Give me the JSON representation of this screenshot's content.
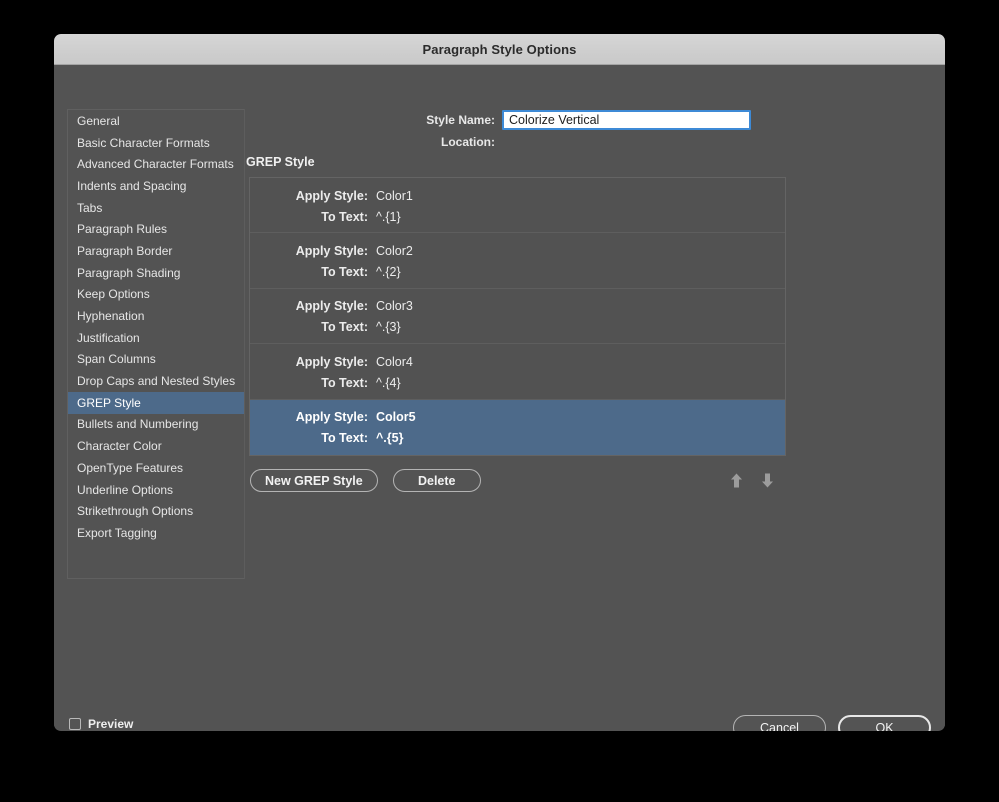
{
  "window": {
    "title": "Paragraph Style Options"
  },
  "sidebar": {
    "items": [
      {
        "label": "General",
        "selected": false
      },
      {
        "label": "Basic Character Formats",
        "selected": false
      },
      {
        "label": "Advanced Character Formats",
        "selected": false
      },
      {
        "label": "Indents and Spacing",
        "selected": false
      },
      {
        "label": "Tabs",
        "selected": false
      },
      {
        "label": "Paragraph Rules",
        "selected": false
      },
      {
        "label": "Paragraph Border",
        "selected": false
      },
      {
        "label": "Paragraph Shading",
        "selected": false
      },
      {
        "label": "Keep Options",
        "selected": false
      },
      {
        "label": "Hyphenation",
        "selected": false
      },
      {
        "label": "Justification",
        "selected": false
      },
      {
        "label": "Span Columns",
        "selected": false
      },
      {
        "label": "Drop Caps and Nested Styles",
        "selected": false
      },
      {
        "label": "GREP Style",
        "selected": true
      },
      {
        "label": "Bullets and Numbering",
        "selected": false
      },
      {
        "label": "Character Color",
        "selected": false
      },
      {
        "label": "OpenType Features",
        "selected": false
      },
      {
        "label": "Underline Options",
        "selected": false
      },
      {
        "label": "Strikethrough Options",
        "selected": false
      },
      {
        "label": "Export Tagging",
        "selected": false
      }
    ]
  },
  "header": {
    "style_name_label": "Style Name:",
    "style_name_value": "Colorize Vertical",
    "location_label": "Location:",
    "location_value": ""
  },
  "main": {
    "section_label": "GREP Style",
    "apply_style_label": "Apply Style:",
    "to_text_label": "To Text:",
    "rows": [
      {
        "apply_style": "Color1",
        "to_text": "^.{1}",
        "selected": false
      },
      {
        "apply_style": "Color2",
        "to_text": "^.{2}",
        "selected": false
      },
      {
        "apply_style": "Color3",
        "to_text": "^.{3}",
        "selected": false
      },
      {
        "apply_style": "Color4",
        "to_text": "^.{4}",
        "selected": false
      },
      {
        "apply_style": "Color5",
        "to_text": "^.{5}",
        "selected": true
      }
    ],
    "new_grep_style_label": "New GREP Style",
    "delete_label": "Delete",
    "move_up_icon": "arrow-up-icon",
    "move_down_icon": "arrow-down-icon"
  },
  "footer": {
    "preview_label": "Preview",
    "preview_checked": false,
    "cancel_label": "Cancel",
    "ok_label": "OK"
  },
  "colors": {
    "dialog_background": "#535353",
    "titlebar": "#d0d0d0",
    "selection_blue": "#4D6A8A",
    "focus_border": "#3D8AD6",
    "text_primary": "#ECECEC"
  }
}
